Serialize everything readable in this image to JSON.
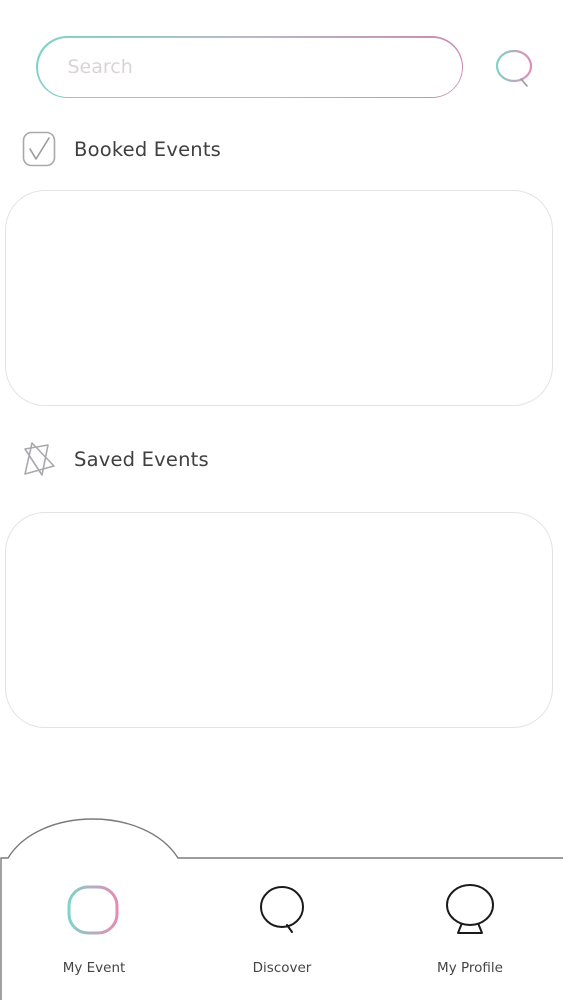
{
  "search": {
    "placeholder": "Search",
    "value": ""
  },
  "sections": {
    "booked": {
      "title": "Booked Events",
      "icon": "checkbox-icon"
    },
    "saved": {
      "title": "Saved Events",
      "icon": "layered-triangles-icon"
    }
  },
  "bottom_nav": {
    "items": [
      {
        "label": "My Event",
        "icon": "menu-lines-icon",
        "active": true
      },
      {
        "label": "Discover",
        "icon": "search-icon",
        "active": false
      },
      {
        "label": "My Profile",
        "icon": "profile-icon",
        "active": false
      }
    ]
  },
  "colors": {
    "accent_teal": "#7fd3c9",
    "accent_pink": "#e58bb6",
    "panel_border": "#e3e3e6"
  }
}
